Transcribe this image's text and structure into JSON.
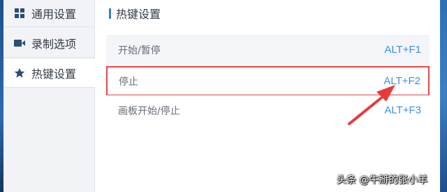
{
  "sidebar": {
    "items": [
      {
        "label": "通用设置",
        "icon": "grid-icon"
      },
      {
        "label": "录制选项",
        "icon": "video-camera-icon"
      },
      {
        "label": "热键设置",
        "icon": "star-icon",
        "selected": true
      }
    ]
  },
  "section": {
    "title": "热键设置"
  },
  "hotkeys": [
    {
      "label": "开始/暂停",
      "key": "ALT+F1"
    },
    {
      "label": "停止",
      "key": "ALT+F2",
      "highlighted": true
    },
    {
      "label": "画板开始/停止",
      "key": "ALT+F3"
    }
  ],
  "annotation": {
    "color": "#e53b3b"
  },
  "watermark": "头条 @牛掰的张小羊",
  "colors": {
    "accent": "#3e8fe0",
    "highlight_border": "#e74646",
    "sidebar_bg": "#f1f3f6"
  }
}
